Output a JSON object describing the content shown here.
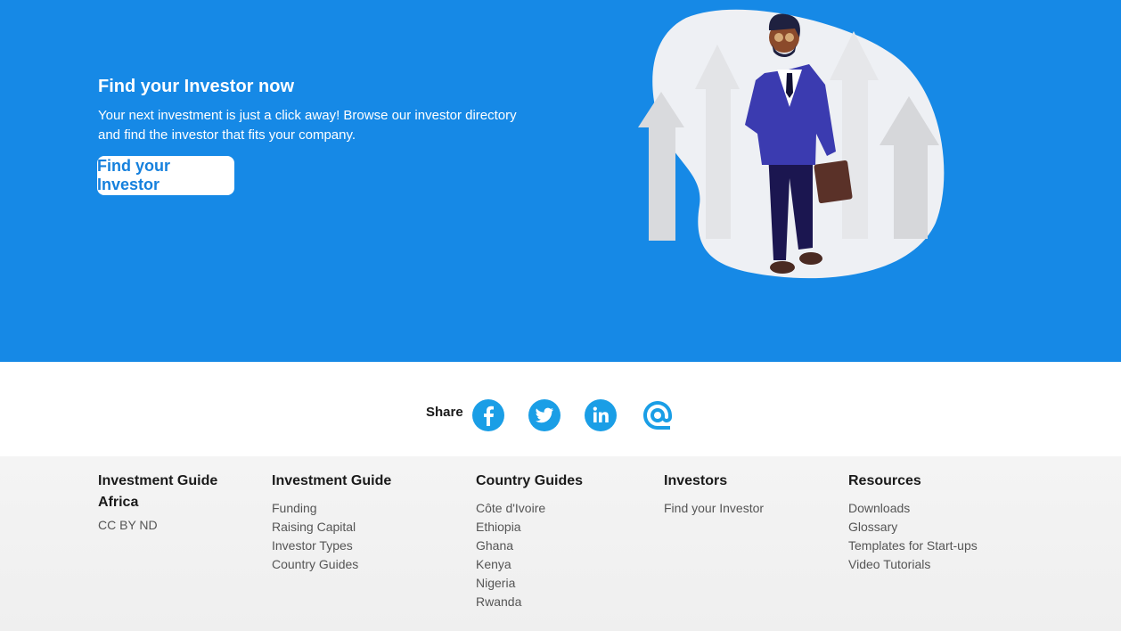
{
  "hero": {
    "title": "Find your Investor now",
    "text": "Your next investment is just a click away! Browse our investor directory and find the investor that fits your company.",
    "button_label": "Find your Investor",
    "colors": {
      "background": "#1689e6",
      "button_text": "#1580dd"
    }
  },
  "share": {
    "label": "Share",
    "icons": [
      "facebook-icon",
      "twitter-icon",
      "linkedin-icon",
      "email-icon"
    ],
    "icon_color": "#1a9ee6"
  },
  "footer": {
    "brand": {
      "title": "Investment Guide Africa",
      "license": "CC BY ND"
    },
    "columns": [
      {
        "title": "Investment Guide",
        "links": [
          "Funding",
          "Raising Capital",
          "Investor Types",
          "Country Guides"
        ]
      },
      {
        "title": "Country Guides",
        "links": [
          "Côte d'Ivoire",
          "Ethiopia",
          "Ghana",
          "Kenya",
          "Nigeria",
          "Rwanda"
        ]
      },
      {
        "title": "Investors",
        "links": [
          "Find your Investor"
        ]
      },
      {
        "title": "Resources",
        "links": [
          "Downloads",
          "Glossary",
          "Templates for Start-ups",
          "Video Tutorials"
        ]
      }
    ]
  }
}
